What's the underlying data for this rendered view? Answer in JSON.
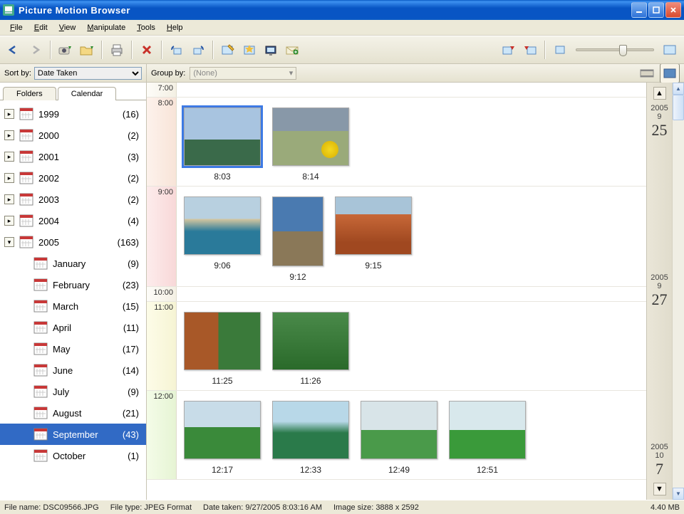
{
  "app": {
    "title": "Picture Motion Browser"
  },
  "menu": {
    "file": "File",
    "edit": "Edit",
    "view": "View",
    "manipulate": "Manipulate",
    "tools": "Tools",
    "help": "Help"
  },
  "sort": {
    "label": "Sort by:",
    "value": "Date Taken"
  },
  "tabs": {
    "folders": "Folders",
    "calendar": "Calendar"
  },
  "years": [
    {
      "label": "1999",
      "count": "(16)",
      "expanded": false
    },
    {
      "label": "2000",
      "count": "(2)",
      "expanded": false
    },
    {
      "label": "2001",
      "count": "(3)",
      "expanded": false
    },
    {
      "label": "2002",
      "count": "(2)",
      "expanded": false
    },
    {
      "label": "2003",
      "count": "(2)",
      "expanded": false
    },
    {
      "label": "2004",
      "count": "(4)",
      "expanded": false
    },
    {
      "label": "2005",
      "count": "(163)",
      "expanded": true
    }
  ],
  "months": [
    {
      "label": "January",
      "count": "(9)",
      "selected": false
    },
    {
      "label": "February",
      "count": "(23)",
      "selected": false
    },
    {
      "label": "March",
      "count": "(15)",
      "selected": false
    },
    {
      "label": "April",
      "count": "(11)",
      "selected": false
    },
    {
      "label": "May",
      "count": "(17)",
      "selected": false
    },
    {
      "label": "June",
      "count": "(14)",
      "selected": false
    },
    {
      "label": "July",
      "count": "(9)",
      "selected": false
    },
    {
      "label": "August",
      "count": "(21)",
      "selected": false
    },
    {
      "label": "September",
      "count": "(43)",
      "selected": true
    },
    {
      "label": "October",
      "count": "(1)",
      "selected": false
    }
  ],
  "group": {
    "label": "Group by:",
    "value": "(None)"
  },
  "hours": {
    "h700": "7:00",
    "h800": "8:00",
    "t803": "8:03",
    "t814": "8:14",
    "h900": "9:00",
    "t906": "9:06",
    "t912": "9:12",
    "t915": "9:15",
    "h1000": "10:00",
    "h1100": "11:00",
    "t1125": "11:25",
    "t1126": "11:26",
    "h1200": "12:00",
    "t1217": "12:17",
    "t1233": "12:33",
    "t1249": "12:49",
    "t1251": "12:51"
  },
  "ribbon": [
    {
      "y": "2005",
      "m": "9",
      "d": "25"
    },
    {
      "y": "2005",
      "m": "9",
      "d": "27"
    },
    {
      "y": "2005",
      "m": "10",
      "d": "7"
    }
  ],
  "status": {
    "filename_label": "File name:",
    "filename": "DSC09566.JPG",
    "filetype_label": "File type:",
    "filetype": "JPEG Format",
    "datetaken_label": "Date taken:",
    "datetaken": "9/27/2005 8:03:16 AM",
    "imgsize_label": "Image size:",
    "imgsize": "3888 x 2592",
    "filesize": "4.40 MB"
  }
}
